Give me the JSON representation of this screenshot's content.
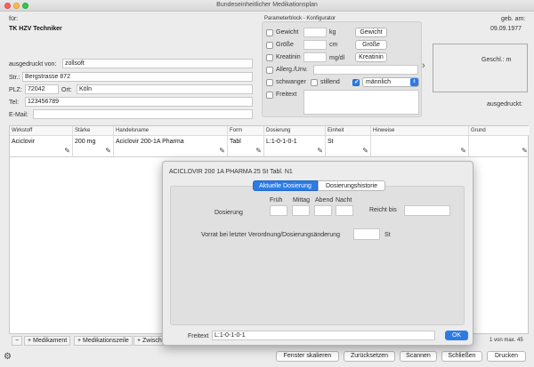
{
  "window": {
    "title": "Bundeseinheitlicher Medikationsplan"
  },
  "header": {
    "fuer_label": "für:",
    "insurer": "TK HZV Techniker",
    "geb_label": "geb. am:",
    "geb_value": "09.09.1977"
  },
  "address": {
    "printed_by_label": "ausgedruckt von:",
    "printed_by_value": "zollsoft",
    "street_label": "Str.:",
    "street_value": "Bergstrasse 872",
    "plz_label": "PLZ:",
    "plz_value": "72042",
    "ort_label": "Ort:",
    "ort_value": "Köln",
    "tel_label": "Tel:",
    "tel_value": "123456789",
    "email_label": "E-Mail:",
    "email_value": ""
  },
  "params": {
    "title": "Parameterblock - Konfigurator",
    "gewicht_label": "Gewicht",
    "gewicht_unit": "kg",
    "gewicht_btn": "Gewicht",
    "groesse_label": "Größe",
    "groesse_unit": "cm",
    "groesse_btn": "Größe",
    "kreatinin_label": "Kreatinin",
    "kreatinin_unit": "mg/dl",
    "kreatinin_btn": "Kreatinin",
    "allerg_label": "Allerg./Unv.",
    "schwanger_label": "schwanger",
    "stillend_label": "stillend",
    "gender_value": "männlich",
    "freitext_label": "Freitext"
  },
  "right": {
    "geschl_label": "Geschl.: m",
    "ausgedruckt_label": "ausgedruckt:"
  },
  "table": {
    "headers": [
      "Wirkstoff",
      "Stärke",
      "Handelsname",
      "Form",
      "Dosierung",
      "Einheit",
      "Hinweise",
      "Grund"
    ],
    "row": [
      "Aciclovir",
      "200 mg",
      "Aciclovir 200-1A Pharma",
      "Tabl",
      "L:1-0-1-0-1",
      "St",
      "",
      ""
    ]
  },
  "modal": {
    "title": "ACICLOVIR 200 1A PHARMA 25 St Tabl. N1",
    "tab_active": "Aktuelle Dosierung",
    "tab_other": "Dosierungshistorie",
    "col_frueh": "Früh",
    "col_mittag": "Mittag",
    "col_abend": "Abend",
    "col_nacht": "Nacht",
    "reicht_bis": "Reicht bis",
    "dosierung_label": "Dosierung",
    "vorrat_label": "Vorrat bei letzter Verordnung/Dosierungsänderung",
    "vorrat_unit": "St",
    "freitext_label": "Freitext",
    "freitext_value": "L:1-0-1-0-1",
    "ok_label": "OK"
  },
  "bottom": {
    "minus": "−",
    "add_medikament": "+ Medikament",
    "add_zeile": "+ Medikationszeile",
    "add_zwischen": "+ Zwisch",
    "page_info": "1 von max. 45"
  },
  "footer": {
    "skalieren": "Fenster skalieren",
    "zuruecksetzen": "Zurücksetzen",
    "scannen": "Scannen",
    "schliessen": "Schließen",
    "drucken": "Drucken"
  }
}
